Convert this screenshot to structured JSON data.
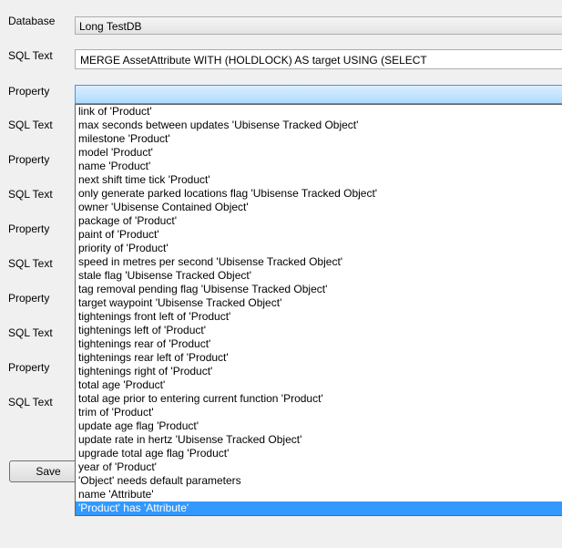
{
  "form": {
    "database_label": "Database",
    "database_value": "Long TestDB",
    "sql_label": "SQL Text",
    "property_label": "Property",
    "sql_text_1": "MERGE AssetAttribute WITH (HOLDLOCK) AS target USING (SELECT",
    "property_value": "",
    "save_label": "Save"
  },
  "dropdown": {
    "items": [
      "link of 'Product'",
      "max seconds between updates 'Ubisense Tracked Object'",
      "milestone 'Product'",
      "model 'Product'",
      "name 'Product'",
      "next shift time tick 'Product'",
      "only generate parked locations flag 'Ubisense Tracked Object'",
      "owner 'Ubisense Contained Object'",
      "package of 'Product'",
      "paint of 'Product'",
      "priority of 'Product'",
      "speed in metres per second 'Ubisense Tracked Object'",
      "stale flag 'Ubisense Tracked Object'",
      "tag removal pending flag 'Ubisense Tracked Object'",
      "target waypoint 'Ubisense Tracked Object'",
      "tightenings front left of 'Product'",
      "tightenings left of 'Product'",
      "tightenings rear of 'Product'",
      "tightenings rear left of 'Product'",
      "tightenings right of 'Product'",
      "total age 'Product'",
      "total age prior to entering current function 'Product'",
      "trim of 'Product'",
      "update age flag 'Product'",
      "update rate in hertz 'Ubisense Tracked Object'",
      "upgrade total age flag 'Product'",
      "year of 'Product'",
      "'Object' needs default parameters",
      "name 'Attribute'",
      "'Product' has 'Attribute'"
    ],
    "selected_index": 29
  }
}
